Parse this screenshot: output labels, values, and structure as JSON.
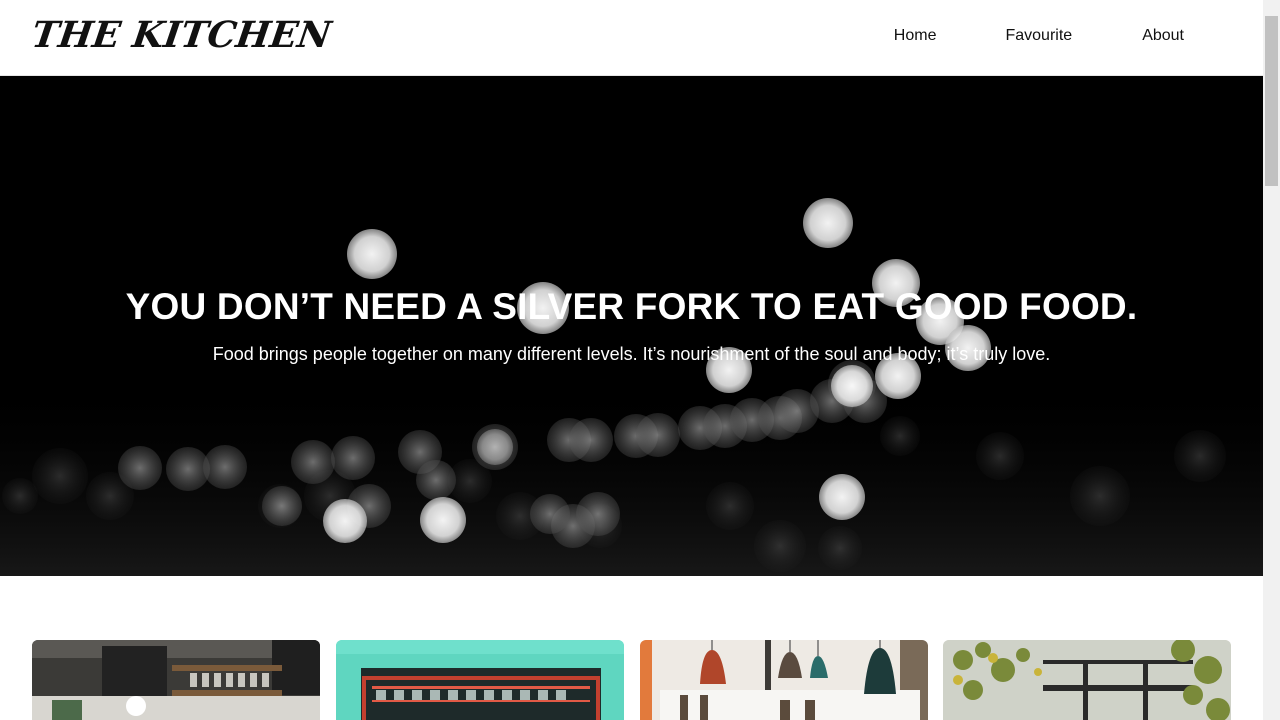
{
  "header": {
    "logo_text": "THE KITCHEN",
    "nav": [
      {
        "label": "Home"
      },
      {
        "label": "Favourite"
      },
      {
        "label": "About"
      }
    ]
  },
  "hero": {
    "title": "YOU DON’T NEED A SILVER FORK TO EAT GOOD FOOD.",
    "subtitle": "Food brings people together on many different levels. It’s nourishment of the soul and body; it’s truly love.",
    "background": "bokeh lights on black"
  },
  "cards": [
    {
      "image": "restaurant-kitchen-interior"
    },
    {
      "image": "teal-storefront-red-window"
    },
    {
      "image": "cafe-pendant-lamps"
    },
    {
      "image": "greenhouse-plants-window"
    }
  ],
  "colors": {
    "text": "#111111",
    "hero_bg": "#000000",
    "hero_text": "#ffffff"
  }
}
